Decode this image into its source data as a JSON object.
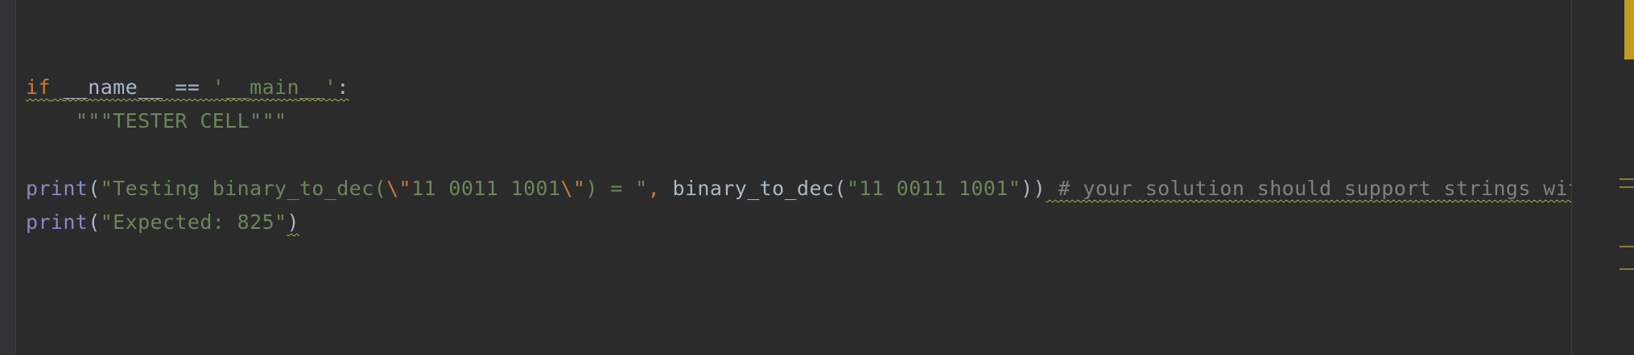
{
  "editor": {
    "lines": {
      "l1": {
        "kw_if": "if",
        "dunder_name": "__name__",
        "eq": " == ",
        "main_str": "'__main__'",
        "colon": ":"
      },
      "l2": {
        "indent": "    ",
        "docstring": "\"\"\"TESTER CELL\"\"\""
      },
      "l4": {
        "print": "print",
        "paren_open": "(",
        "str_part1": "\"Testing binary_to_dec(",
        "esc1": "\\\"",
        "str_part2": "11 0011 1001",
        "esc2": "\\\"",
        "str_part3": ") = \"",
        "comma": ", ",
        "func": "binary_to_dec",
        "paren_open2": "(",
        "arg": "\"11 0011 1001\"",
        "paren_close": "))",
        "comment": " # your solution should support strings wit"
      },
      "l5": {
        "print": "print",
        "paren_open": "(",
        "arg": "\"Expected: 825\"",
        "paren_close": ")"
      }
    }
  },
  "colors": {
    "background": "#2b2b2b",
    "keyword": "#cc7832",
    "string": "#6a8759",
    "builtin": "#8888c6",
    "comment": "#808080",
    "text": "#a9b7c6",
    "warning_marker": "#c29b1f"
  }
}
